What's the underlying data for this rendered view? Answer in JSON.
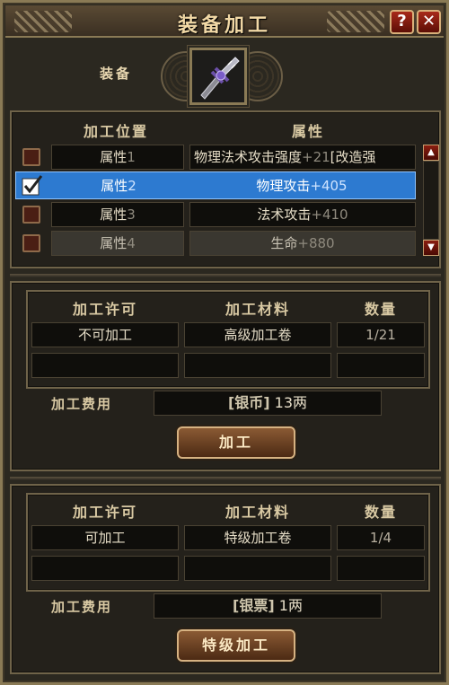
{
  "title": "装备加工",
  "window_buttons": {
    "help": "?",
    "close": "✕"
  },
  "equip": {
    "label": "装备",
    "icon": "sword-icon"
  },
  "attr_table": {
    "headers": {
      "position": "加工位置",
      "attribute": "属性"
    },
    "rows": [
      {
        "slot_name": "属性",
        "slot_num": "1",
        "attr_name": "物理法术攻击强度",
        "attr_val": "+21",
        "attr_extra": "[改造强",
        "checked": false,
        "selected": false,
        "dimmed": false
      },
      {
        "slot_name": "属性",
        "slot_num": "2",
        "attr_name": "物理攻击",
        "attr_val": "+405",
        "attr_extra": "",
        "checked": true,
        "selected": true,
        "dimmed": false
      },
      {
        "slot_name": "属性",
        "slot_num": "3",
        "attr_name": "法术攻击",
        "attr_val": "+410",
        "attr_extra": "",
        "checked": false,
        "selected": false,
        "dimmed": false
      },
      {
        "slot_name": "属性",
        "slot_num": "4",
        "attr_name": "生命",
        "attr_val": "+880",
        "attr_extra": "",
        "checked": false,
        "selected": false,
        "dimmed": true
      }
    ]
  },
  "normal": {
    "headers": {
      "permit": "加工许可",
      "material": "加工材料",
      "count": "数量"
    },
    "permit": "不可加工",
    "material": "高级加工卷",
    "count": "1/21",
    "cost_label": "加工费用",
    "currency": "银币",
    "cost_amount": "13",
    "cost_unit": "两",
    "button": "加工"
  },
  "special": {
    "headers": {
      "permit": "加工许可",
      "material": "加工材料",
      "count": "数量"
    },
    "permit": "可加工",
    "material": "特级加工卷",
    "count": "1/4",
    "cost_label": "加工费用",
    "currency": "银票",
    "cost_amount": "1",
    "cost_unit": "两",
    "button": "特级加工"
  },
  "colors": {
    "selection": "#2d7ad0",
    "accent": "#8a7a55",
    "button": "#8a5a34"
  }
}
